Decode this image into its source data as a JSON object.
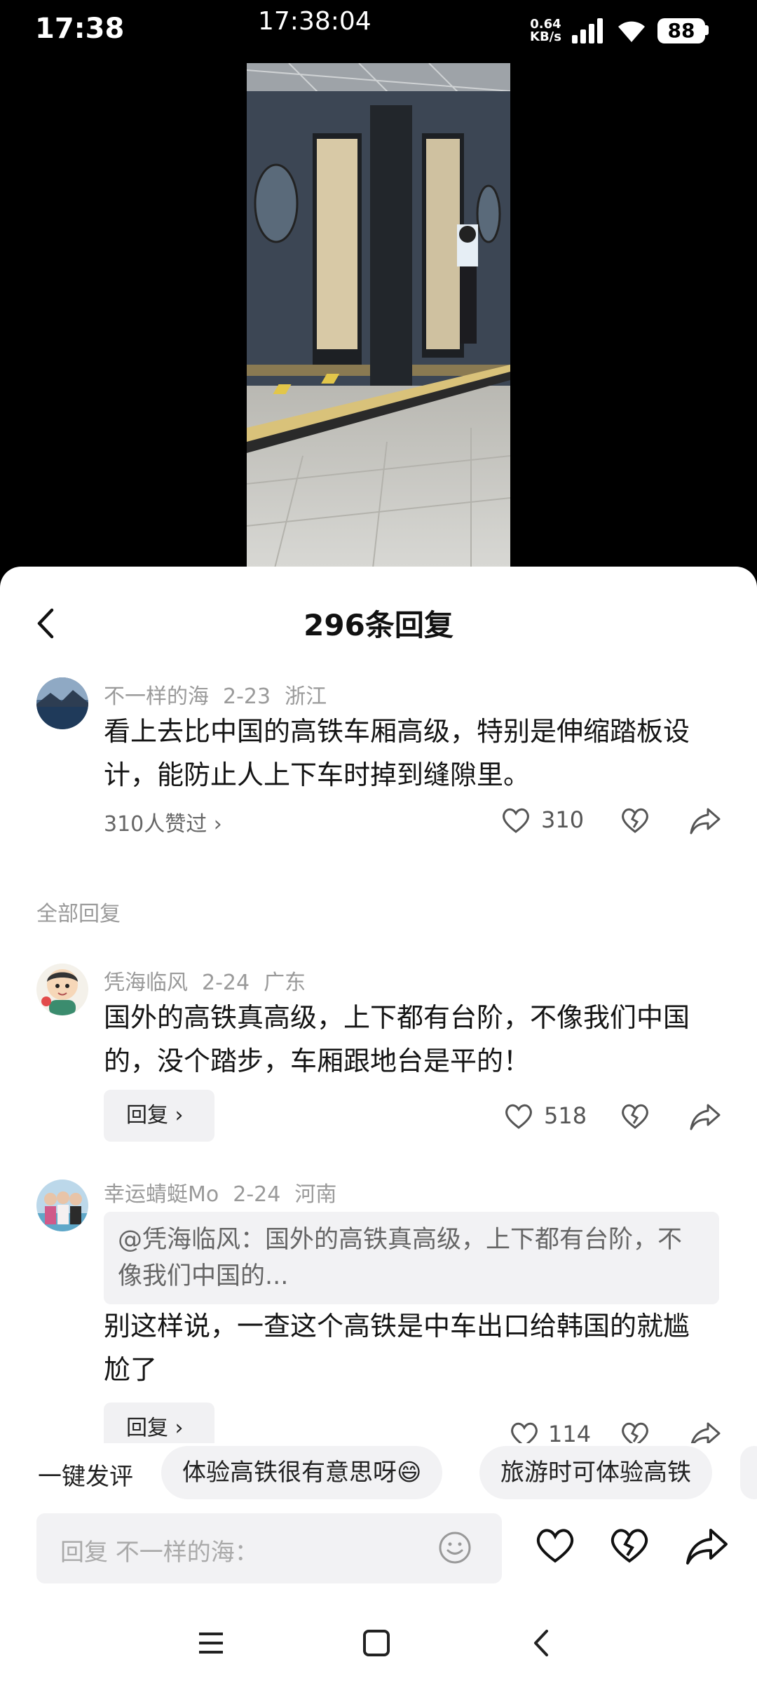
{
  "status_bar": {
    "time": "17:38",
    "clock": "17:38:04",
    "speed_value": "0.64",
    "speed_unit": "KB/s",
    "battery": "88"
  },
  "sheet": {
    "title": "296条回复"
  },
  "root_comment": {
    "author": "不一样的海",
    "date": "2-23",
    "location": "浙江",
    "text": "看上去比中国的高铁车厢高级，特别是伸缩踏板设计，能防止人上下车时掉到缝隙里。",
    "likers_label": "310人赞过",
    "likes": "310"
  },
  "section_label": "全部回复",
  "replies": [
    {
      "author": "凭海临风",
      "date": "2-24",
      "location": "广东",
      "text": "国外的高铁真高级，上下都有台阶，不像我们中国的，没个踏步，车厢跟地台是平的！",
      "reply_label": "回复",
      "likes": "518"
    },
    {
      "author": "幸运蜻蜓Mo",
      "date": "2-24",
      "location": "河南",
      "quote": "@凭海临风：国外的高铁真高级，上下都有台阶，不像我们中国的...",
      "text": "别这样说，一查这个高铁是中车出口给韩国的就尴尬了",
      "reply_label": "回复",
      "likes": "114"
    }
  ],
  "quick_reply": {
    "label": "一键发评",
    "chips": [
      "体验高铁很有意思呀😄",
      "旅游时可体验高铁"
    ]
  },
  "input": {
    "placeholder": "回复 不一样的海："
  },
  "colors": {
    "sheet_bg": "#ffffff",
    "chip_bg": "#f2f2f4",
    "meta_text": "#9a9a9a"
  }
}
